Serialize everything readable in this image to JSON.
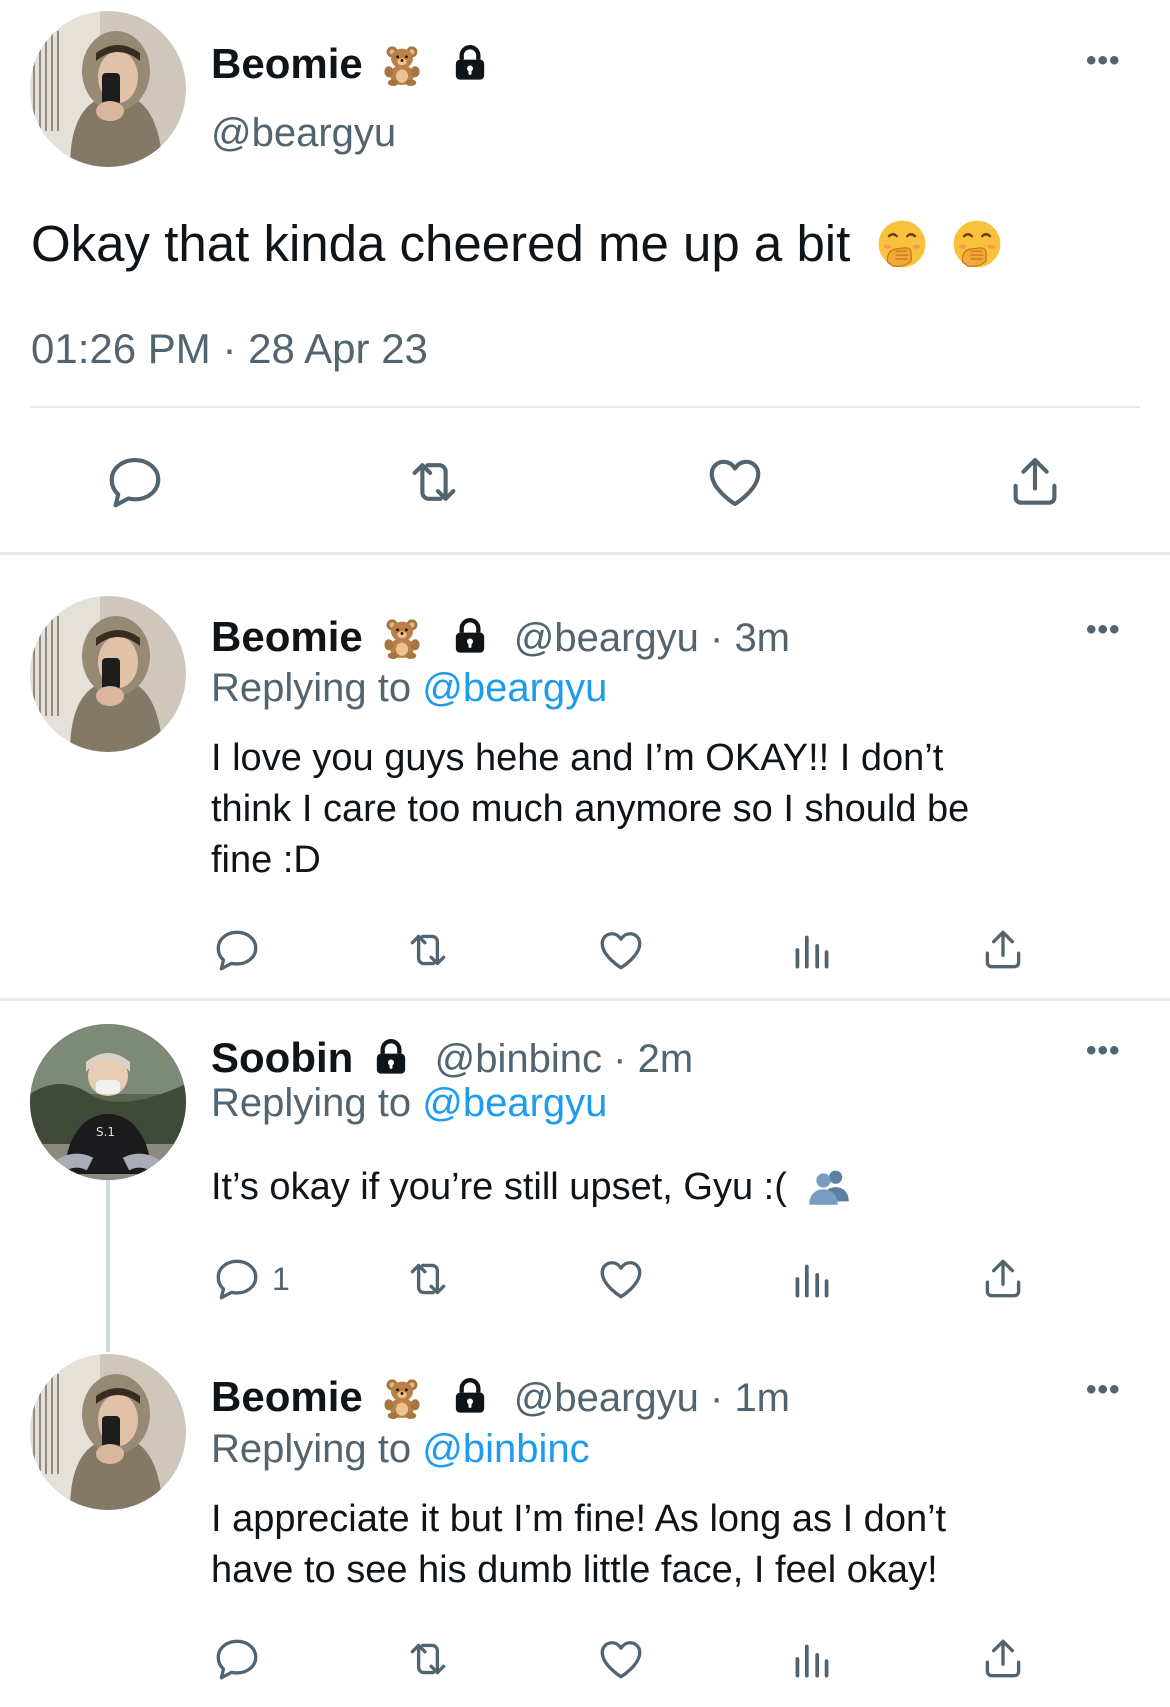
{
  "main_tweet": {
    "author": "Beomie",
    "handle": "@beargyu",
    "text": "Okay that kinda cheered me up a bit",
    "timestamp": "01:26 PM · 28 Apr 23"
  },
  "replies": [
    {
      "author": "Beomie",
      "handle": "@beargyu · 3m",
      "replying_label": "Replying to",
      "replying_to": "@beargyu",
      "text_line1": "I love you guys hehe and I’m OKAY!! I don’t",
      "text_line2": "think I care too much anymore so I should be",
      "text_line3": "fine :D",
      "reply_count": ""
    },
    {
      "author": "Soobin",
      "handle": "@binbinc · 2m",
      "replying_label": "Replying to",
      "replying_to": "@beargyu",
      "text": "It’s okay if you’re still upset, Gyu :(",
      "reply_count": "1"
    },
    {
      "author": "Beomie",
      "handle": "@beargyu · 1m",
      "replying_label": "Replying to",
      "replying_to": "@binbinc",
      "text_line1": "I appreciate it but I’m fine! As long as I don’t",
      "text_line2": "have to see his dumb little face, I feel okay!",
      "reply_count": ""
    }
  ],
  "icons": {
    "verified_emoji": "teddy-bear",
    "lock": "lock-icon",
    "main_emoji": "face-with-hand-over-mouth",
    "soobin_emoji": "busts-in-silhouette",
    "actions": [
      "reply-icon",
      "retweet-icon",
      "like-icon",
      "analytics-icon",
      "share-icon"
    ]
  },
  "colors": {
    "link": "#1d9bf0",
    "secondary": "#536471",
    "divider": "#e7e9ea"
  }
}
